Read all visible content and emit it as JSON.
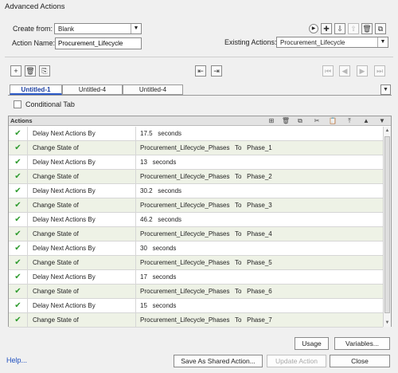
{
  "window": {
    "title": "Advanced Actions"
  },
  "header": {
    "create_from_label": "Create from:",
    "create_from_value": "Blank",
    "action_name_label": "Action Name:",
    "action_name_value": "Procurement_Lifecycle",
    "existing_actions_label": "Existing Actions:",
    "existing_actions_value": "Procurement_Lifecycle"
  },
  "tabs": [
    {
      "label": "Untitled-1"
    },
    {
      "label": "Untitled-4"
    },
    {
      "label": "Untitled-4"
    }
  ],
  "conditional_tab_label": "Conditional Tab",
  "actions_panel": {
    "title": "Actions",
    "rows": [
      {
        "action": "Delay Next Actions By",
        "param": "17.5   seconds"
      },
      {
        "action": "Change State of",
        "param": "Procurement_Lifecycle_Phases   To   Phase_1"
      },
      {
        "action": "Delay Next Actions By",
        "param": "13   seconds"
      },
      {
        "action": "Change State of",
        "param": "Procurement_Lifecycle_Phases   To   Phase_2"
      },
      {
        "action": "Delay Next Actions By",
        "param": "30.2   seconds"
      },
      {
        "action": "Change State of",
        "param": "Procurement_Lifecycle_Phases   To   Phase_3"
      },
      {
        "action": "Delay Next Actions By",
        "param": "46.2   seconds"
      },
      {
        "action": "Change State of",
        "param": "Procurement_Lifecycle_Phases   To   Phase_4"
      },
      {
        "action": "Delay Next Actions By",
        "param": "30   seconds"
      },
      {
        "action": "Change State of",
        "param": "Procurement_Lifecycle_Phases   To   Phase_5"
      },
      {
        "action": "Delay Next Actions By",
        "param": "17   seconds"
      },
      {
        "action": "Change State of",
        "param": "Procurement_Lifecycle_Phases   To   Phase_6"
      },
      {
        "action": "Delay Next Actions By",
        "param": "15   seconds"
      },
      {
        "action": "Change State of",
        "param": "Procurement_Lifecycle_Phases   To   Phase_7"
      }
    ]
  },
  "buttons": {
    "usage": "Usage",
    "variables": "Variables...",
    "help": "Help...",
    "save_shared": "Save As Shared Action...",
    "update_action": "Update Action",
    "close": "Close"
  },
  "colors": {
    "check": "#2e9b2e",
    "alt_row": "#eef2e6",
    "active_tab": "#1a3da0",
    "link": "#1f4fbf"
  }
}
